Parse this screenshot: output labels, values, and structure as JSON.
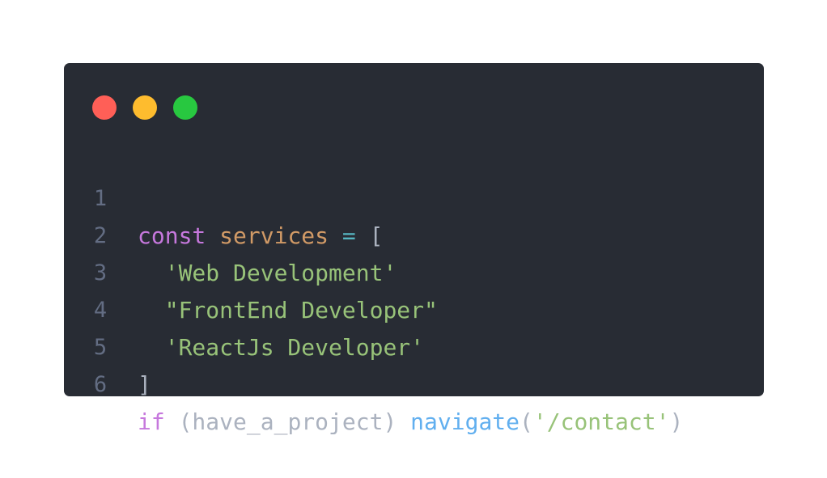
{
  "window": {
    "controls": {
      "close_color": "#ff5f57",
      "minimize_color": "#febc2e",
      "maximize_color": "#28c840"
    }
  },
  "code": {
    "lines": [
      {
        "number": "1",
        "tokens": {
          "kw": "const",
          "var": "services",
          "op": "=",
          "punc": "["
        }
      },
      {
        "number": "2",
        "tokens": {
          "str": "'Web Development'"
        }
      },
      {
        "number": "3",
        "tokens": {
          "str": "\"FrontEnd Developer\""
        }
      },
      {
        "number": "4",
        "tokens": {
          "str": "'ReactJs Developer'"
        }
      },
      {
        "number": "5",
        "tokens": {
          "punc": "]"
        }
      },
      {
        "number": "6",
        "tokens": {
          "kw": "if",
          "cond": "(have_a_project)",
          "fn": "navigate",
          "paren_open": "(",
          "str": "'/contact'",
          "paren_close": ")"
        }
      }
    ]
  }
}
